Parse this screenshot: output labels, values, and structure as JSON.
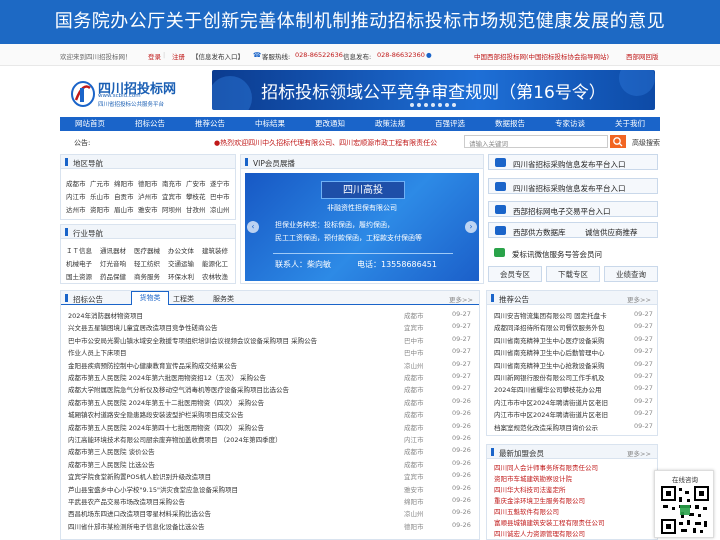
{
  "banner": {
    "title": "国务院办公厅关于创新完善体制机制推动招标投标市场规范健康发展的意见"
  },
  "topbar": {
    "welcome": "欢迎来到四川招投标网！",
    "login": "登录",
    "register": "注册",
    "info_entry": "【信息发布入口】",
    "hotline_label": "客服热线:",
    "hotline": "028-86522636",
    "info_label": "信息发布:",
    "info_phone": "028-86632360",
    "guide": "中国西部招投标网(中国招标投标协会指导网站)",
    "site_west": "西部网回版"
  },
  "header": {
    "logo_title": "四川招投标网",
    "logo_url": "www.scbid.com",
    "logo_sub": "四川省招投标公共服务平台",
    "ad_text": "招标投标领域公平竞争审查规则（第16号令）"
  },
  "nav": [
    "网站首页",
    "招标公告",
    "推荐公告",
    "中标结果",
    "更改通知",
    "政策法规",
    "百强评选",
    "数据报告",
    "专家访谈",
    "关于我们"
  ],
  "bulletin": {
    "label": "公告:",
    "text": "●热烈欢迎四川中久招标代理有限公司、四川宏顺源市政工程有限责任公",
    "search_placeholder": "请输入关键词",
    "adv_search": "高级搜索"
  },
  "region_nav": {
    "title": "地区导航",
    "rows": [
      [
        "成都市",
        "广元市",
        "绵阳市",
        "德阳市",
        "南充市",
        "广安市",
        "遂宁市"
      ],
      [
        "内江市",
        "乐山市",
        "自贡市",
        "泸州市",
        "宜宾市",
        "攀枝花",
        "巴中市"
      ],
      [
        "达州市",
        "资阳市",
        "眉山市",
        "雅安市",
        "阿坝州",
        "甘孜州",
        "凉山州"
      ]
    ]
  },
  "industry_nav": {
    "title": "行业导航",
    "rows": [
      [
        "ＩＴ信息",
        "通讯器材",
        "医疗器械",
        "办公文体",
        "建筑装修"
      ],
      [
        "机械电子",
        "灯光音响",
        "轻工纺织",
        "交通运输",
        "能源化工"
      ],
      [
        "国土资源",
        "药品保健",
        "商务服务",
        "环保水利",
        "农林牧渔"
      ]
    ]
  },
  "vip": {
    "title": "VIP会员展播",
    "company": "四川高投",
    "company_sub": "非融资性担保有限公司",
    "line1": "担保业务种类：投标保函，履约保函，",
    "line2": "民工工资保函，预付款保函，工程款支付保函等",
    "contact": "联系人：柴向敏",
    "phone": "电话：13558686451"
  },
  "right_buttons": [
    "四川省招标采购信息发布平台入口",
    "四川省招标采购信息发布平台入口",
    "西部招标网电子交易平台入口",
    "西部供方数据库",
    "诚信供应商推荐",
    "爱标讯微信服务号答会员问"
  ],
  "member_buttons": [
    "会员专区",
    "下载专区",
    "业绩查询"
  ],
  "announcements": {
    "title": "招标公告",
    "tabs": [
      "货物类",
      "工程类",
      "服务类"
    ],
    "more": "更多>>",
    "rows": [
      {
        "title": "2024年消防器材物资项目",
        "city": "成都市",
        "date": "09-27"
      },
      {
        "title": "兴文县五星镇困境儿童宜居改造项目竞争性磋商公告",
        "city": "宜宾市",
        "date": "09-27"
      },
      {
        "title": "巴中市公安局光雾山镇水域安全救援专项组织培训会议视频会议设备采购项目 采购公告",
        "city": "巴中市",
        "date": "09-27"
      },
      {
        "title": "作业人员上下床项目",
        "city": "巴中市",
        "date": "09-27"
      },
      {
        "title": "金阳县疾病预防控制中心健康教育宣传品采购成交结果公告",
        "city": "凉山州",
        "date": "09-27"
      },
      {
        "title": "成都市第五人民医院 2024年第六批医用物资招12（五次） 采购公告",
        "city": "成都市",
        "date": "09-27"
      },
      {
        "title": "成都大学附属医院急气分析仪及移动空气消毒机等医疗设备采购项目比选公告",
        "city": "成都市",
        "date": "09-27"
      },
      {
        "title": "成都市第五人民医院 2024年第五十二批医用物资（四次） 采购公告",
        "city": "成都市",
        "date": "09-26"
      },
      {
        "title": "城厢镇农村道路安全隐患路段安装波型护栏采购项目成交公告",
        "city": "成都市",
        "date": "09-26"
      },
      {
        "title": "成都市第五人民医院 2024年第四十七批医用物资（四次） 采购公告",
        "city": "成都市",
        "date": "09-26"
      },
      {
        "title": "内江高能环境技术有限公司厨余废弃物加盖收费项目 （2024年第四季度）",
        "city": "内江市",
        "date": "09-26"
      },
      {
        "title": "成都市第三人民医院 谈价公告",
        "city": "成都市",
        "date": "09-26"
      },
      {
        "title": "成都市第三人民医院 比选公告",
        "city": "成都市",
        "date": "09-26"
      },
      {
        "title": "宜宾学院食堂新购置POS机人脸识别升级改造项目",
        "city": "宜宾市",
        "date": "09-26"
      },
      {
        "title": "芦山县宝盛乡中心小学校\"9.15\"洪灾食堂应急设备采购项目",
        "city": "雅安市",
        "date": "09-26"
      },
      {
        "title": "平武县农产品交易市场改造项目采购公告",
        "city": "绵阳市",
        "date": "09-26"
      },
      {
        "title": "西昌机场东四进口改造项目零星材料采购比选公告",
        "city": "凉山州",
        "date": "09-26"
      },
      {
        "title": "四川省什邡市某检测所电子信息化设备比选公告",
        "city": "德阳市",
        "date": "09-26"
      }
    ]
  },
  "recommend": {
    "title": "推荐公告",
    "more": "更多>>",
    "rows": [
      {
        "title": "四川安吉物流集团有限公司 固定托盘卡",
        "date": "09-27"
      },
      {
        "title": "成都同泽招待所有限公司餐饮服务外包",
        "date": "09-27"
      },
      {
        "title": "四川省南充精神卫生中心医疗设备采购",
        "date": "09-27"
      },
      {
        "title": "四川省南充精神卫生中心后勤管理中心",
        "date": "09-27"
      },
      {
        "title": "四川省南充精神卫生中心抢救设备采购",
        "date": "09-27"
      },
      {
        "title": "四川新网银行股份有限公司工作手机及",
        "date": "09-27"
      },
      {
        "title": "2024年四川省耀华公司攀枝花办公用",
        "date": "09-27"
      },
      {
        "title": "内江市市中区2024年聘请街道片区老旧",
        "date": "09-27"
      },
      {
        "title": "内江市市中区2024年聘请街道片区老旧",
        "date": "09-27"
      },
      {
        "title": "档案室规范化改造采购项目询价公示",
        "date": "09-27"
      }
    ]
  },
  "new_members": {
    "title": "最新加盟会员",
    "more": "更多>>",
    "rows": [
      "四川同人会计师事务所有限责任公司",
      "资阳市车城建筑勘察设计院",
      "四川华大科技司法鉴定所",
      "重庆金涂环境卫生服务有限公司",
      "四川五魁软件有限公司",
      "富顺县城镇建筑安装工程有限责任公司",
      "四川诚宏人力资源管理有限公司"
    ]
  },
  "online": {
    "label": "在线咨询"
  },
  "colors": {
    "primary": "#1a64c9",
    "banner": "#1d69c4",
    "accent_red": "#c01919"
  }
}
